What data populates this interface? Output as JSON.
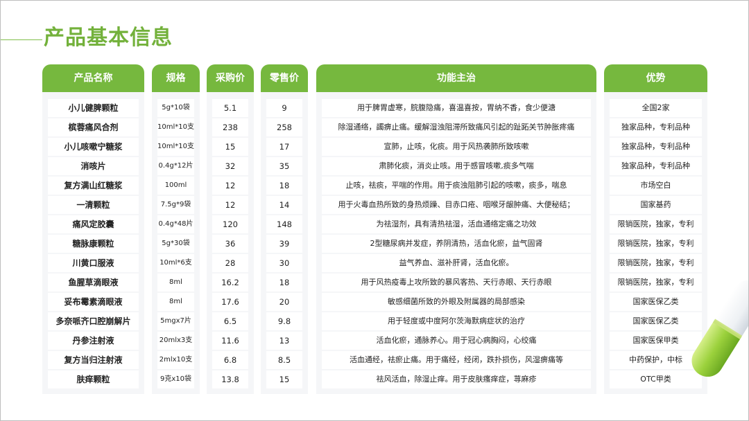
{
  "page": {
    "title": "产品基本信息"
  },
  "table": {
    "headers": {
      "name": "产品名称",
      "spec": "规格",
      "buy": "采购价",
      "sell": "零售价",
      "func": "功能主治",
      "adv": "优势"
    },
    "rows": [
      {
        "name": "小儿健脾颗粒",
        "spec": "5g*10袋",
        "buy": "5.1",
        "sell": "9",
        "func": "用于脾胃虚寒，脘腹隐痛，喜温喜按，胃纳不香，食少便溏",
        "adv": "全国2家"
      },
      {
        "name": "槟蓉痛风合剂",
        "spec": "10ml*10支",
        "buy": "238",
        "sell": "258",
        "func": "除湿通络，蠲痹止痛。缓解湿浊阻滞所致痛风引起的趾跖关节肿胀疼痛",
        "adv": "独家品种，专利品种"
      },
      {
        "name": "小儿咳嗽宁糖浆",
        "spec": "10ml*10支",
        "buy": "15",
        "sell": "17",
        "func": "宣肺，止咳，化痰。用于风热袭肺所致咳嗽",
        "adv": "独家品种，专利品种"
      },
      {
        "name": "消咳片",
        "spec": "0.4g*12片",
        "buy": "32",
        "sell": "35",
        "func": "肃肺化痰，消炎止咳。用于感冒咳嗽,痰多气喘",
        "adv": "独家品种，专利品种"
      },
      {
        "name": "复方满山红糖浆",
        "spec": "100ml",
        "buy": "12",
        "sell": "18",
        "func": "止咳，祛痰，平喘的作用。用于痰浊阻肺引起的咳嗽，痰多，喘息",
        "adv": "市场空白"
      },
      {
        "name": "一清颗粒",
        "spec": "7.5g*9袋",
        "buy": "12",
        "sell": "14",
        "func": "用于火毒血热所致的身热烦躁、目赤口疮、咽喉牙龈肿痛、大便秘结；",
        "adv": "国家基药"
      },
      {
        "name": "痛风定胶囊",
        "spec": "0.4g*48片",
        "buy": "120",
        "sell": "148",
        "func": "为祛湿剂，具有清热祛湿，活血通络定痛之功效",
        "adv": "限销医院，独家，专利"
      },
      {
        "name": "糖脉康颗粒",
        "spec": "5g*30袋",
        "buy": "36",
        "sell": "39",
        "func": "2型糖尿病并发症，养阴清热，活血化瘀，益气固肾",
        "adv": "限销医院，独家，专利"
      },
      {
        "name": "川黄口服液",
        "spec": "10ml*6支",
        "buy": "28",
        "sell": "30",
        "func": "益气养血、滋补肝肾，活血化瘀。",
        "adv": "限销医院，独家，专利"
      },
      {
        "name": "鱼腥草滴眼液",
        "spec": "8ml",
        "buy": "16.2",
        "sell": "18",
        "func": "用于风热疫毒上攻所致的暴风客热、天行赤眼、天行赤眼",
        "adv": "限销医院，独家，专利"
      },
      {
        "name": "妥布霉素滴眼液",
        "spec": "8ml",
        "buy": "17.6",
        "sell": "20",
        "func": "敏感细菌所致的外眼及附属器的局部感染",
        "adv": "国家医保乙类"
      },
      {
        "name": "多奈哌齐口腔崩解片",
        "spec": "5mgx7片",
        "buy": "6.5",
        "sell": "9.8",
        "func": "用于轻度或中度阿尔茨海默病症状的治疗",
        "adv": "国家医保乙类"
      },
      {
        "name": "丹参注射液",
        "spec": "20mlx3支",
        "buy": "11.6",
        "sell": "13",
        "func": "活血化瘀，通脉养心。用于冠心病胸闷，心绞痛",
        "adv": "国家医保甲类"
      },
      {
        "name": "复方当归注射液",
        "spec": "2mlx10支",
        "buy": "6.8",
        "sell": "8.5",
        "func": "活血通经，祛瘀止痛。用于痛经，经闭，跌扑损伤，风湿痹痛等",
        "adv": "中药保护，中标"
      },
      {
        "name": "肤痒颗粒",
        "spec": "9克x10袋",
        "buy": "13.8",
        "sell": "15",
        "func": "祛风活血，除湿止痒。用于皮肤瘙痒症，荨麻疹",
        "adv": "OTC甲类"
      }
    ]
  },
  "colors": {
    "accent": "#76b83e",
    "title": "#73b13b",
    "column_bg": "#f5f6f8"
  },
  "decoration": {
    "icon": "capsule-icon"
  }
}
